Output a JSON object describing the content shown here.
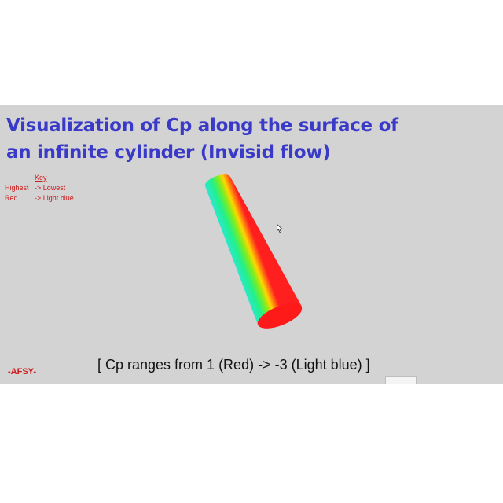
{
  "slide": {
    "title_line1": "Visualization of Cp along the surface of",
    "title_line2": "an infinite cylinder (Invisid flow)",
    "key": {
      "heading": "Key",
      "row1_left": "Highest",
      "row1_right": "-> Lowest",
      "row2_left": "Red",
      "row2_right": "-> Light blue"
    },
    "caption": "[ Cp ranges from 1 (Red) -> -3 (Light blue) ]",
    "author": "-AFSY-"
  },
  "colors": {
    "background": "#d3d3d3",
    "title": "#3a3ac8",
    "key_text": "#cc1a1a",
    "cp_high": "#ff1a1a",
    "cp_low": "#33e8e0"
  },
  "icons": [
    "mouse-cursor-icon"
  ]
}
